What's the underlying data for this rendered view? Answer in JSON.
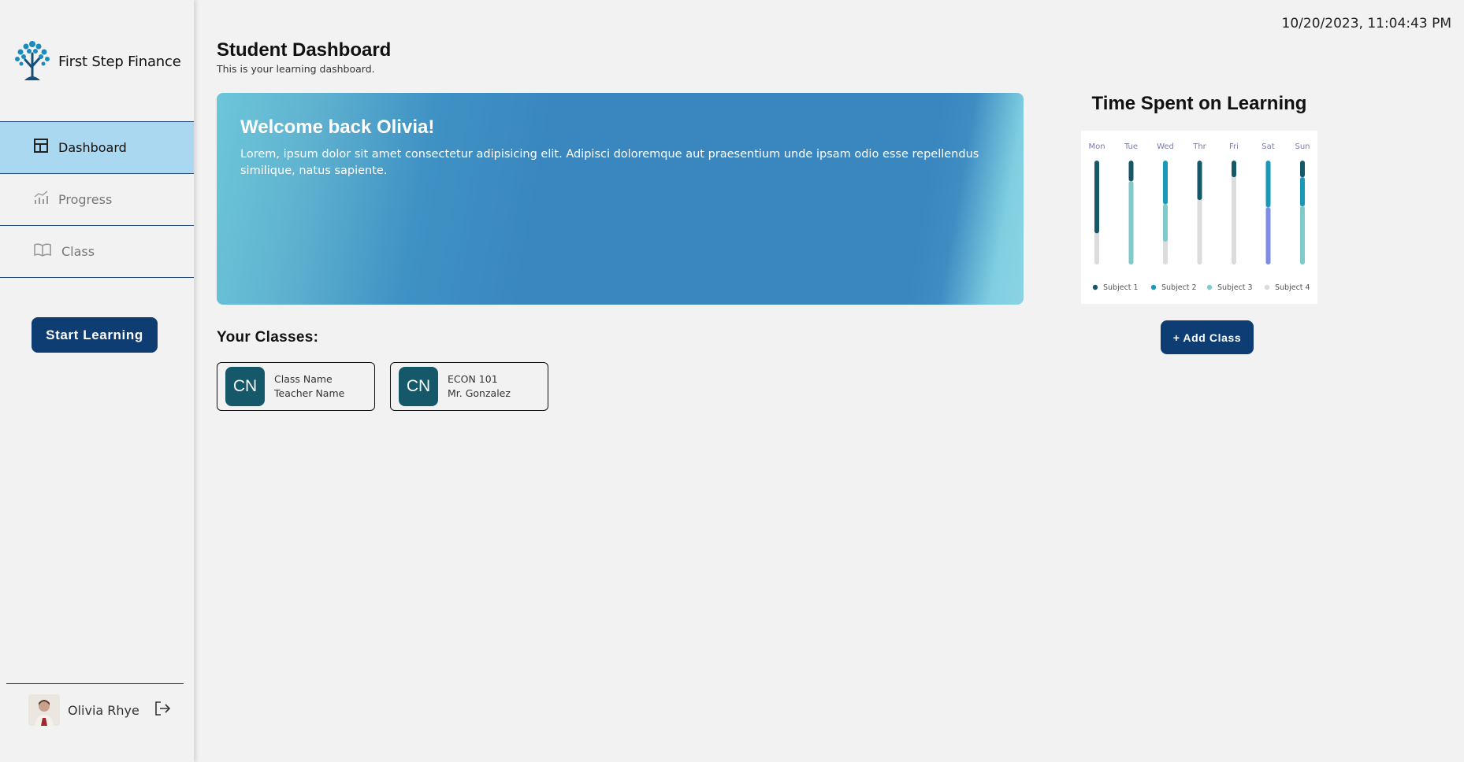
{
  "brand": {
    "name": "First Step Finance",
    "logo_icon": "tree-icon",
    "color": "#1a8bbd"
  },
  "sidebar": {
    "items": [
      {
        "label": "Dashboard",
        "icon": "dashboard-icon",
        "active": true
      },
      {
        "label": "Progress",
        "icon": "chart-icon",
        "active": false
      },
      {
        "label": "Class",
        "icon": "book-icon",
        "active": false
      }
    ],
    "start_button": "Start Learning",
    "user": {
      "name": "Olivia Rhye",
      "logout_icon": "logout-icon"
    }
  },
  "header": {
    "datetime": "10/20/2023, 11:04:43 PM",
    "title": "Student Dashboard",
    "subtitle": "This is your learning dashboard."
  },
  "banner": {
    "title": "Welcome back Olivia!",
    "text": "Lorem, ipsum dolor sit amet consectetur adipisicing elit. Adipisci doloremque aut praesentium unde ipsam odio esse repellendus similique, natus sapiente."
  },
  "classes": {
    "heading": "Your Classes:",
    "items": [
      {
        "initials": "CN",
        "name": "Class Name",
        "teacher": "Teacher Name"
      },
      {
        "initials": "CN",
        "name": "ECON 101",
        "teacher": "Mr. Gonzalez"
      }
    ]
  },
  "chart_panel": {
    "title": "Time Spent on Learning",
    "add_button": "+ Add Class"
  },
  "chart_data": {
    "type": "bar",
    "stacked": true,
    "categories": [
      "Mon",
      "Tue",
      "Wed",
      "Thr",
      "Fri",
      "Sat",
      "Sun"
    ],
    "series": [
      {
        "name": "Subject 1",
        "color": "#14586a",
        "values": [
          70,
          20,
          0,
          38,
          16,
          0,
          16
        ]
      },
      {
        "name": "Subject 2",
        "color": "#1899b8",
        "values": [
          0,
          0,
          42,
          0,
          0,
          0,
          28
        ]
      },
      {
        "name": "Subject 3",
        "color": "#7fcbcb",
        "values": [
          0,
          80,
          36,
          0,
          0,
          0,
          56
        ]
      },
      {
        "name": "Subject 4",
        "color": "#dcdcdc",
        "values": [
          30,
          0,
          22,
          62,
          84,
          0,
          0
        ]
      }
    ],
    "extra_segments": [
      {
        "category": "Sat",
        "segments": [
          {
            "color": "#1899b8",
            "value": 45
          },
          {
            "color": "#7d8ee8",
            "value": 55
          }
        ]
      }
    ],
    "legend": "bottom",
    "grid": false
  }
}
